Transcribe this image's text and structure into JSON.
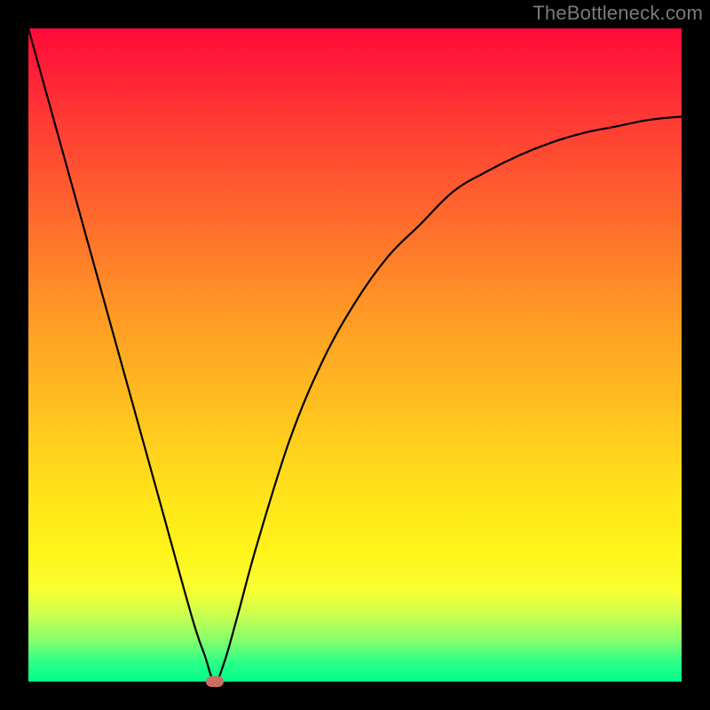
{
  "watermark": "TheBottleneck.com",
  "chart_data": {
    "type": "line",
    "title": "",
    "xlabel": "",
    "ylabel": "",
    "xlim": [
      0,
      100
    ],
    "ylim": [
      0,
      100
    ],
    "grid": false,
    "series": [
      {
        "name": "bottleneck-curve",
        "x": [
          0,
          5,
          10,
          15,
          20,
          25,
          27,
          28.5,
          30,
          32,
          35,
          40,
          45,
          50,
          55,
          60,
          65,
          70,
          75,
          80,
          85,
          90,
          95,
          100
        ],
        "values": [
          100,
          82,
          64,
          46,
          28,
          10,
          4,
          0,
          3,
          10,
          21,
          37,
          49,
          58,
          65,
          70,
          75,
          78,
          80.5,
          82.5,
          84,
          85,
          86,
          86.5
        ]
      }
    ],
    "marker": {
      "x": 28.5,
      "y": 0
    },
    "background_gradient": {
      "top": "#ff0b3a",
      "mid": "#ffd800",
      "bottom": "#00ff88"
    }
  }
}
